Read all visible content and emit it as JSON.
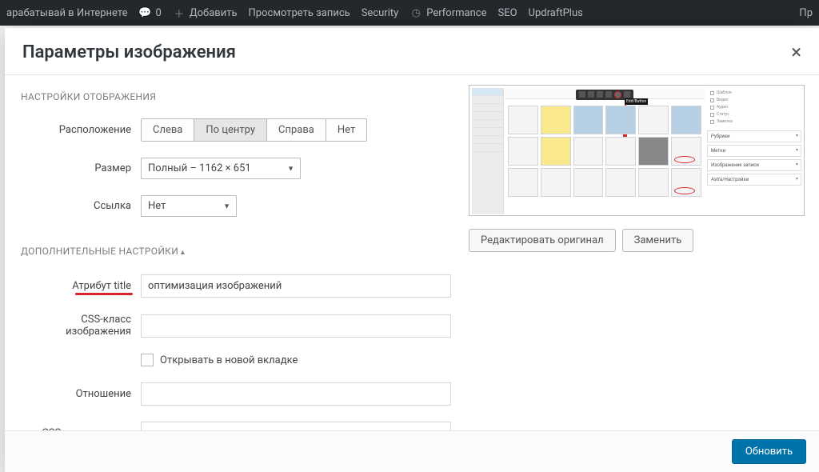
{
  "adminbar": {
    "site": "арабатывай в Интернете",
    "comments": "0",
    "add": "Добавить",
    "view": "Просмотреть запись",
    "security": "Security",
    "performance": "Performance",
    "seo": "SEO",
    "updraft": "UpdraftPlus",
    "right": "Пр"
  },
  "modal": {
    "title": "Параметры изображения"
  },
  "sections": {
    "display": "НАСТРОЙКИ ОТОБРАЖЕНИЯ",
    "advanced": "ДОПОЛНИТЕЛЬНЫЕ НАСТРОЙКИ"
  },
  "labels": {
    "align": "Расположение",
    "size": "Размер",
    "link": "Ссылка",
    "title_attr": "Атрибут title",
    "img_class": "CSS-класс изображения",
    "newtab": "Открывать в новой вкладке",
    "rel": "Отношение",
    "link_class": "CSS-класс ссылки"
  },
  "align_options": {
    "left": "Слева",
    "center": "По центру",
    "right": "Справа",
    "none": "Нет"
  },
  "size_value": "Полный – 1162 × 651",
  "link_value": "Нет",
  "title_value": "оптимизация изображений",
  "preview_actions": {
    "edit": "Редактировать оригинал",
    "replace": "Заменить"
  },
  "preview_sidepanels": {
    "rubrics": "Рубрики",
    "tags": "Метки",
    "featured": "Изображение записи",
    "astra": "Astra/Настройки"
  },
  "preview_tooltip": "Edit/Button",
  "footer": {
    "update": "Обновить"
  }
}
